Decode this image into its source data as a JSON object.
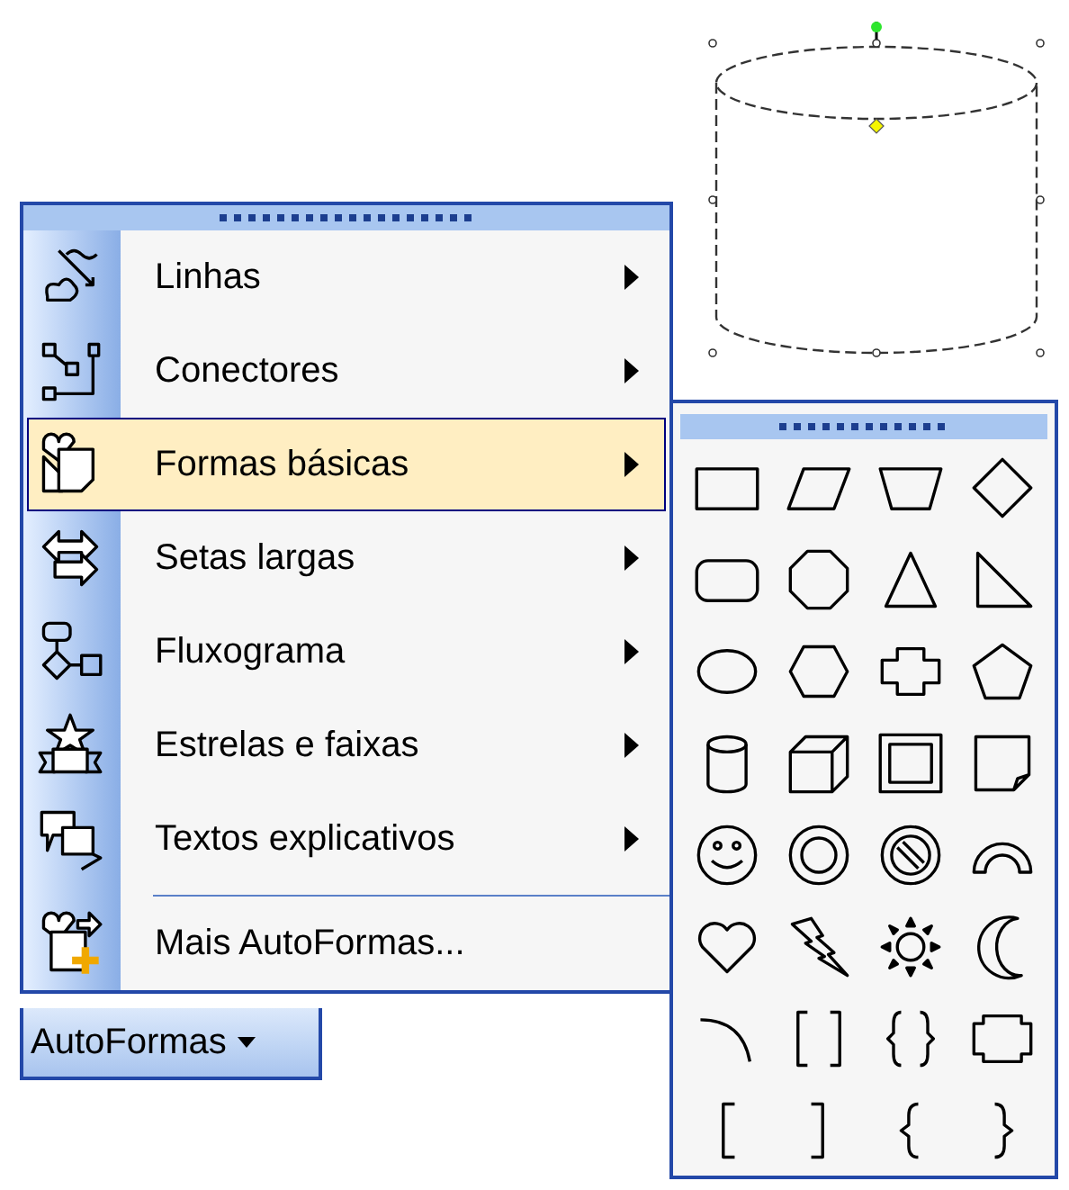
{
  "menu": {
    "items": [
      {
        "kind": "submenu",
        "label": "Linhas",
        "selected": false
      },
      {
        "kind": "submenu",
        "label": "Conectores",
        "selected": false
      },
      {
        "kind": "submenu",
        "label": "Formas básicas",
        "selected": true
      },
      {
        "kind": "submenu",
        "label": "Setas largas",
        "selected": false
      },
      {
        "kind": "submenu",
        "label": "Fluxograma",
        "selected": false
      },
      {
        "kind": "submenu",
        "label": "Estrelas e faixas",
        "selected": false
      },
      {
        "kind": "submenu",
        "label": "Textos explicativos",
        "selected": false
      },
      {
        "kind": "separator"
      },
      {
        "kind": "command",
        "label": "Mais AutoFormas...",
        "selected": false
      }
    ]
  },
  "autoshapes_button": {
    "label": "AutoFormas"
  }
}
